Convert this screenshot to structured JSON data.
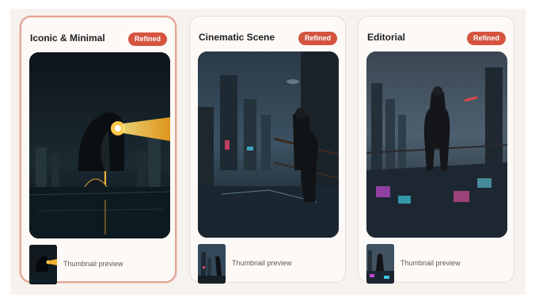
{
  "styles": [
    {
      "title": "Iconic & Minimal",
      "badge": "Refined",
      "selected": true,
      "thumb_label": "Thumbnail preview"
    },
    {
      "title": "Cinematic Scene",
      "badge": "Refined",
      "selected": false,
      "thumb_label": "Thumbnail preview"
    },
    {
      "title": "Editorial",
      "badge": "Refined",
      "selected": false,
      "thumb_label": "Thumbnail preview"
    }
  ],
  "colors": {
    "badge": "#d4543f",
    "selected_border": "#e1a494",
    "panel_bg": "#f6f2ee",
    "card_bg": "#fcf9f7"
  }
}
